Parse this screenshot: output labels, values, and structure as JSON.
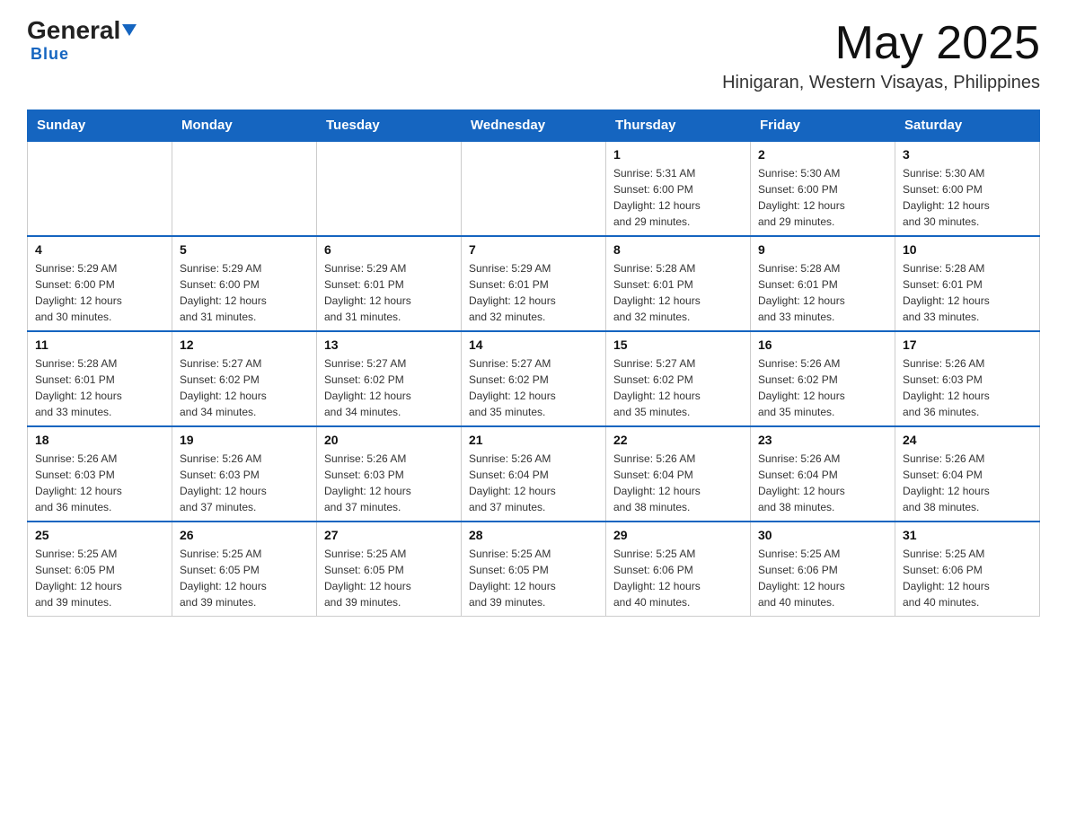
{
  "header": {
    "logo_general": "General",
    "logo_blue": "Blue",
    "month": "May 2025",
    "location": "Hinigaran, Western Visayas, Philippines"
  },
  "days_of_week": [
    "Sunday",
    "Monday",
    "Tuesday",
    "Wednesday",
    "Thursday",
    "Friday",
    "Saturday"
  ],
  "weeks": [
    [
      {
        "day": "",
        "info": ""
      },
      {
        "day": "",
        "info": ""
      },
      {
        "day": "",
        "info": ""
      },
      {
        "day": "",
        "info": ""
      },
      {
        "day": "1",
        "info": "Sunrise: 5:31 AM\nSunset: 6:00 PM\nDaylight: 12 hours\nand 29 minutes."
      },
      {
        "day": "2",
        "info": "Sunrise: 5:30 AM\nSunset: 6:00 PM\nDaylight: 12 hours\nand 29 minutes."
      },
      {
        "day": "3",
        "info": "Sunrise: 5:30 AM\nSunset: 6:00 PM\nDaylight: 12 hours\nand 30 minutes."
      }
    ],
    [
      {
        "day": "4",
        "info": "Sunrise: 5:29 AM\nSunset: 6:00 PM\nDaylight: 12 hours\nand 30 minutes."
      },
      {
        "day": "5",
        "info": "Sunrise: 5:29 AM\nSunset: 6:00 PM\nDaylight: 12 hours\nand 31 minutes."
      },
      {
        "day": "6",
        "info": "Sunrise: 5:29 AM\nSunset: 6:01 PM\nDaylight: 12 hours\nand 31 minutes."
      },
      {
        "day": "7",
        "info": "Sunrise: 5:29 AM\nSunset: 6:01 PM\nDaylight: 12 hours\nand 32 minutes."
      },
      {
        "day": "8",
        "info": "Sunrise: 5:28 AM\nSunset: 6:01 PM\nDaylight: 12 hours\nand 32 minutes."
      },
      {
        "day": "9",
        "info": "Sunrise: 5:28 AM\nSunset: 6:01 PM\nDaylight: 12 hours\nand 33 minutes."
      },
      {
        "day": "10",
        "info": "Sunrise: 5:28 AM\nSunset: 6:01 PM\nDaylight: 12 hours\nand 33 minutes."
      }
    ],
    [
      {
        "day": "11",
        "info": "Sunrise: 5:28 AM\nSunset: 6:01 PM\nDaylight: 12 hours\nand 33 minutes."
      },
      {
        "day": "12",
        "info": "Sunrise: 5:27 AM\nSunset: 6:02 PM\nDaylight: 12 hours\nand 34 minutes."
      },
      {
        "day": "13",
        "info": "Sunrise: 5:27 AM\nSunset: 6:02 PM\nDaylight: 12 hours\nand 34 minutes."
      },
      {
        "day": "14",
        "info": "Sunrise: 5:27 AM\nSunset: 6:02 PM\nDaylight: 12 hours\nand 35 minutes."
      },
      {
        "day": "15",
        "info": "Sunrise: 5:27 AM\nSunset: 6:02 PM\nDaylight: 12 hours\nand 35 minutes."
      },
      {
        "day": "16",
        "info": "Sunrise: 5:26 AM\nSunset: 6:02 PM\nDaylight: 12 hours\nand 35 minutes."
      },
      {
        "day": "17",
        "info": "Sunrise: 5:26 AM\nSunset: 6:03 PM\nDaylight: 12 hours\nand 36 minutes."
      }
    ],
    [
      {
        "day": "18",
        "info": "Sunrise: 5:26 AM\nSunset: 6:03 PM\nDaylight: 12 hours\nand 36 minutes."
      },
      {
        "day": "19",
        "info": "Sunrise: 5:26 AM\nSunset: 6:03 PM\nDaylight: 12 hours\nand 37 minutes."
      },
      {
        "day": "20",
        "info": "Sunrise: 5:26 AM\nSunset: 6:03 PM\nDaylight: 12 hours\nand 37 minutes."
      },
      {
        "day": "21",
        "info": "Sunrise: 5:26 AM\nSunset: 6:04 PM\nDaylight: 12 hours\nand 37 minutes."
      },
      {
        "day": "22",
        "info": "Sunrise: 5:26 AM\nSunset: 6:04 PM\nDaylight: 12 hours\nand 38 minutes."
      },
      {
        "day": "23",
        "info": "Sunrise: 5:26 AM\nSunset: 6:04 PM\nDaylight: 12 hours\nand 38 minutes."
      },
      {
        "day": "24",
        "info": "Sunrise: 5:26 AM\nSunset: 6:04 PM\nDaylight: 12 hours\nand 38 minutes."
      }
    ],
    [
      {
        "day": "25",
        "info": "Sunrise: 5:25 AM\nSunset: 6:05 PM\nDaylight: 12 hours\nand 39 minutes."
      },
      {
        "day": "26",
        "info": "Sunrise: 5:25 AM\nSunset: 6:05 PM\nDaylight: 12 hours\nand 39 minutes."
      },
      {
        "day": "27",
        "info": "Sunrise: 5:25 AM\nSunset: 6:05 PM\nDaylight: 12 hours\nand 39 minutes."
      },
      {
        "day": "28",
        "info": "Sunrise: 5:25 AM\nSunset: 6:05 PM\nDaylight: 12 hours\nand 39 minutes."
      },
      {
        "day": "29",
        "info": "Sunrise: 5:25 AM\nSunset: 6:06 PM\nDaylight: 12 hours\nand 40 minutes."
      },
      {
        "day": "30",
        "info": "Sunrise: 5:25 AM\nSunset: 6:06 PM\nDaylight: 12 hours\nand 40 minutes."
      },
      {
        "day": "31",
        "info": "Sunrise: 5:25 AM\nSunset: 6:06 PM\nDaylight: 12 hours\nand 40 minutes."
      }
    ]
  ]
}
